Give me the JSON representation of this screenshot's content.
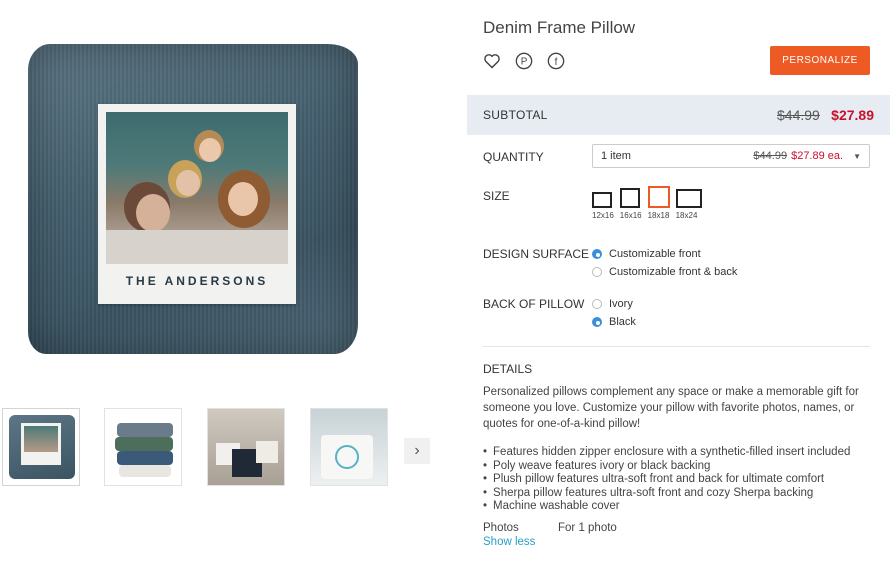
{
  "product": {
    "title": "Denim Frame Pillow",
    "photo_caption": "THE ANDERSONS"
  },
  "social": [
    {
      "name": "heart-icon",
      "glyph": "♡"
    },
    {
      "name": "pinterest-icon",
      "glyph": "P"
    },
    {
      "name": "facebook-icon",
      "glyph": "f"
    }
  ],
  "actions": {
    "personalize_label": "PERSONALIZE"
  },
  "subtotal": {
    "label": "SUBTOTAL",
    "old_price": "$44.99",
    "new_price": "$27.89"
  },
  "quantity": {
    "label": "QUANTITY",
    "selected": "1 item",
    "old_price": "$44.99",
    "new_price": "$27.89 ea."
  },
  "size": {
    "label": "SIZE",
    "options": [
      {
        "label": "12x16",
        "selected": false
      },
      {
        "label": "16x16",
        "selected": false
      },
      {
        "label": "18x18",
        "selected": true
      },
      {
        "label": "18x24",
        "selected": false
      }
    ]
  },
  "design_surface": {
    "label": "DESIGN SURFACE",
    "options": [
      {
        "label": "Customizable front",
        "checked": true
      },
      {
        "label": "Customizable front & back",
        "checked": false
      }
    ]
  },
  "back_of_pillow": {
    "label": "BACK OF PILLOW",
    "options": [
      {
        "label": "Ivory",
        "checked": false
      },
      {
        "label": "Black",
        "checked": true
      }
    ]
  },
  "details": {
    "heading": "DETAILS",
    "description": "Personalized pillows complement any space or make a memorable gift for someone you love. Customize your pillow with favorite photos, names, or quotes for one-of-a-kind pillow!",
    "bullets": [
      "Features hidden zipper enclosure with a synthetic-filled insert included",
      "Poly weave features ivory or black backing",
      "Plush pillow features ultra-soft front and back for ultimate comfort",
      "Sherpa pillow features ultra-soft front and cozy Sherpa backing",
      "Machine washable cover"
    ],
    "photos_label": "Photos",
    "photos_value": "For 1 photo",
    "show_less": "Show less"
  },
  "thumbnails": {
    "next_glyph": "›"
  },
  "colors": {
    "accent": "#ee5a24",
    "sale_red": "#c8102e",
    "radio_blue": "#3a8fd8",
    "link": "#2a9fc4",
    "subtotal_bg": "#e6ecf2"
  }
}
